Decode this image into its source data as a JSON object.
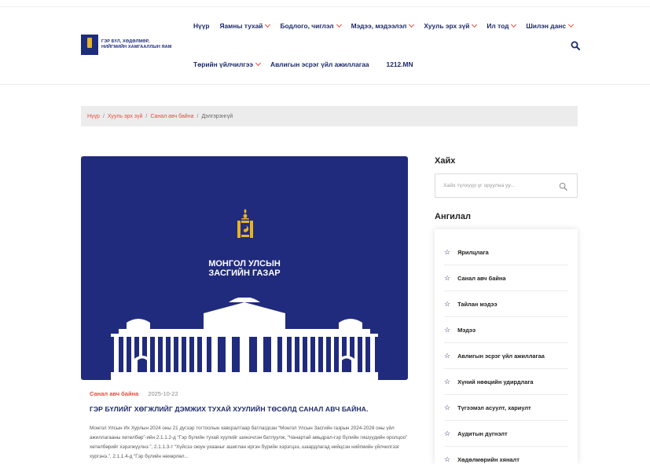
{
  "logo": {
    "text_line1": "ГЭР БҮЛ, ХӨДӨЛМӨР,",
    "text_line2": "НИЙГМИЙН ХАМГААЛЛЫН ЯАМ"
  },
  "nav": {
    "row1": [
      {
        "label": "Нүүр",
        "dropdown": false
      },
      {
        "label": "Яамны тухай",
        "dropdown": true
      },
      {
        "label": "Бодлого, чиглэл",
        "dropdown": true
      },
      {
        "label": "Мэдээ, мэдээлэл",
        "dropdown": true
      },
      {
        "label": "Хууль эрх зүй",
        "dropdown": true
      },
      {
        "label": "Ил тод",
        "dropdown": true
      },
      {
        "label": "Шилэн данс",
        "dropdown": true
      }
    ],
    "row2": [
      {
        "label": "Төрийн үйлчилгээ",
        "dropdown": true
      },
      {
        "label": "Авлигын эсрэг үйл ажиллагаа",
        "dropdown": false
      },
      {
        "label": "1212.MN",
        "dropdown": false
      }
    ]
  },
  "breadcrumb": {
    "items": [
      "Нүүр",
      "Хууль эрх зүй",
      "Санал авч байна"
    ],
    "current": "Дэлгэрэнгүй"
  },
  "hero": {
    "title_line1": "МОНГОЛ УЛСЫН",
    "title_line2": "ЗАСГИЙН ГАЗАР"
  },
  "article": {
    "category": "Санал авч байна",
    "date": "2025-10-22",
    "title": "ГЭР БҮЛИЙГ ХӨГЖЛИЙГ ДЭМЖИХ ТУХАЙ ХУУЛИЙН ТӨСӨЛД САНАЛ АВЧ БАЙНА.",
    "body": "Монгол Улсын Их Хурлын 2024 оны 21 дүгээр тогтоолын хавсралтаар батлагдсан “Монгол Улсын Засгийн газрын 2024-2028 оны үйл ажиллагааны хөтөлбөр”-ийн 2.1.1.2-д “Гэр бүлийн тухай хуулийг шинэчлэн батлуулж, “Чанартай амьдрал-гэр бүлийн гишүүдийн оролцоо” хөтөлбөрийг хэрэгжүүлнэ.”, 2.1.1.3-т “Хүйсээ оюун ухааныг ашиглан иргэн бүрийн хэрэгцээ, шаардлагад нийцсэн нийгмийн үйлчилгээг хүргэнэ.”, 2.1.1.4-д “Гэр бүлийн нөхөрлөл..."
  },
  "sidebar": {
    "search_title": "Хайх",
    "search_placeholder": "Хайх түлхүүр үг оруулна уу...",
    "category_title": "Ангилал",
    "categories": [
      "Ярилцлага",
      "Санал авч байна",
      "Тайлан мэдээ",
      "Мэдээ",
      "Авлигын эсрэг үйл ажиллагаа",
      "Хүний нөөцийн удирдлага",
      "Түгээмэл асуулт, хариулт",
      "Аудитын дүгнэлт",
      "Хөдөлмөрийн хяналт"
    ]
  },
  "colors": {
    "brand_navy": "#1e2a6b",
    "accent_red": "#e84b3c",
    "hero_bg": "#212b7d",
    "gold": "#e6b325"
  },
  "icons": {
    "search": "magnifier-icon",
    "category_bullet": "star-outline-icon",
    "dropdown": "chevron-down-icon"
  }
}
